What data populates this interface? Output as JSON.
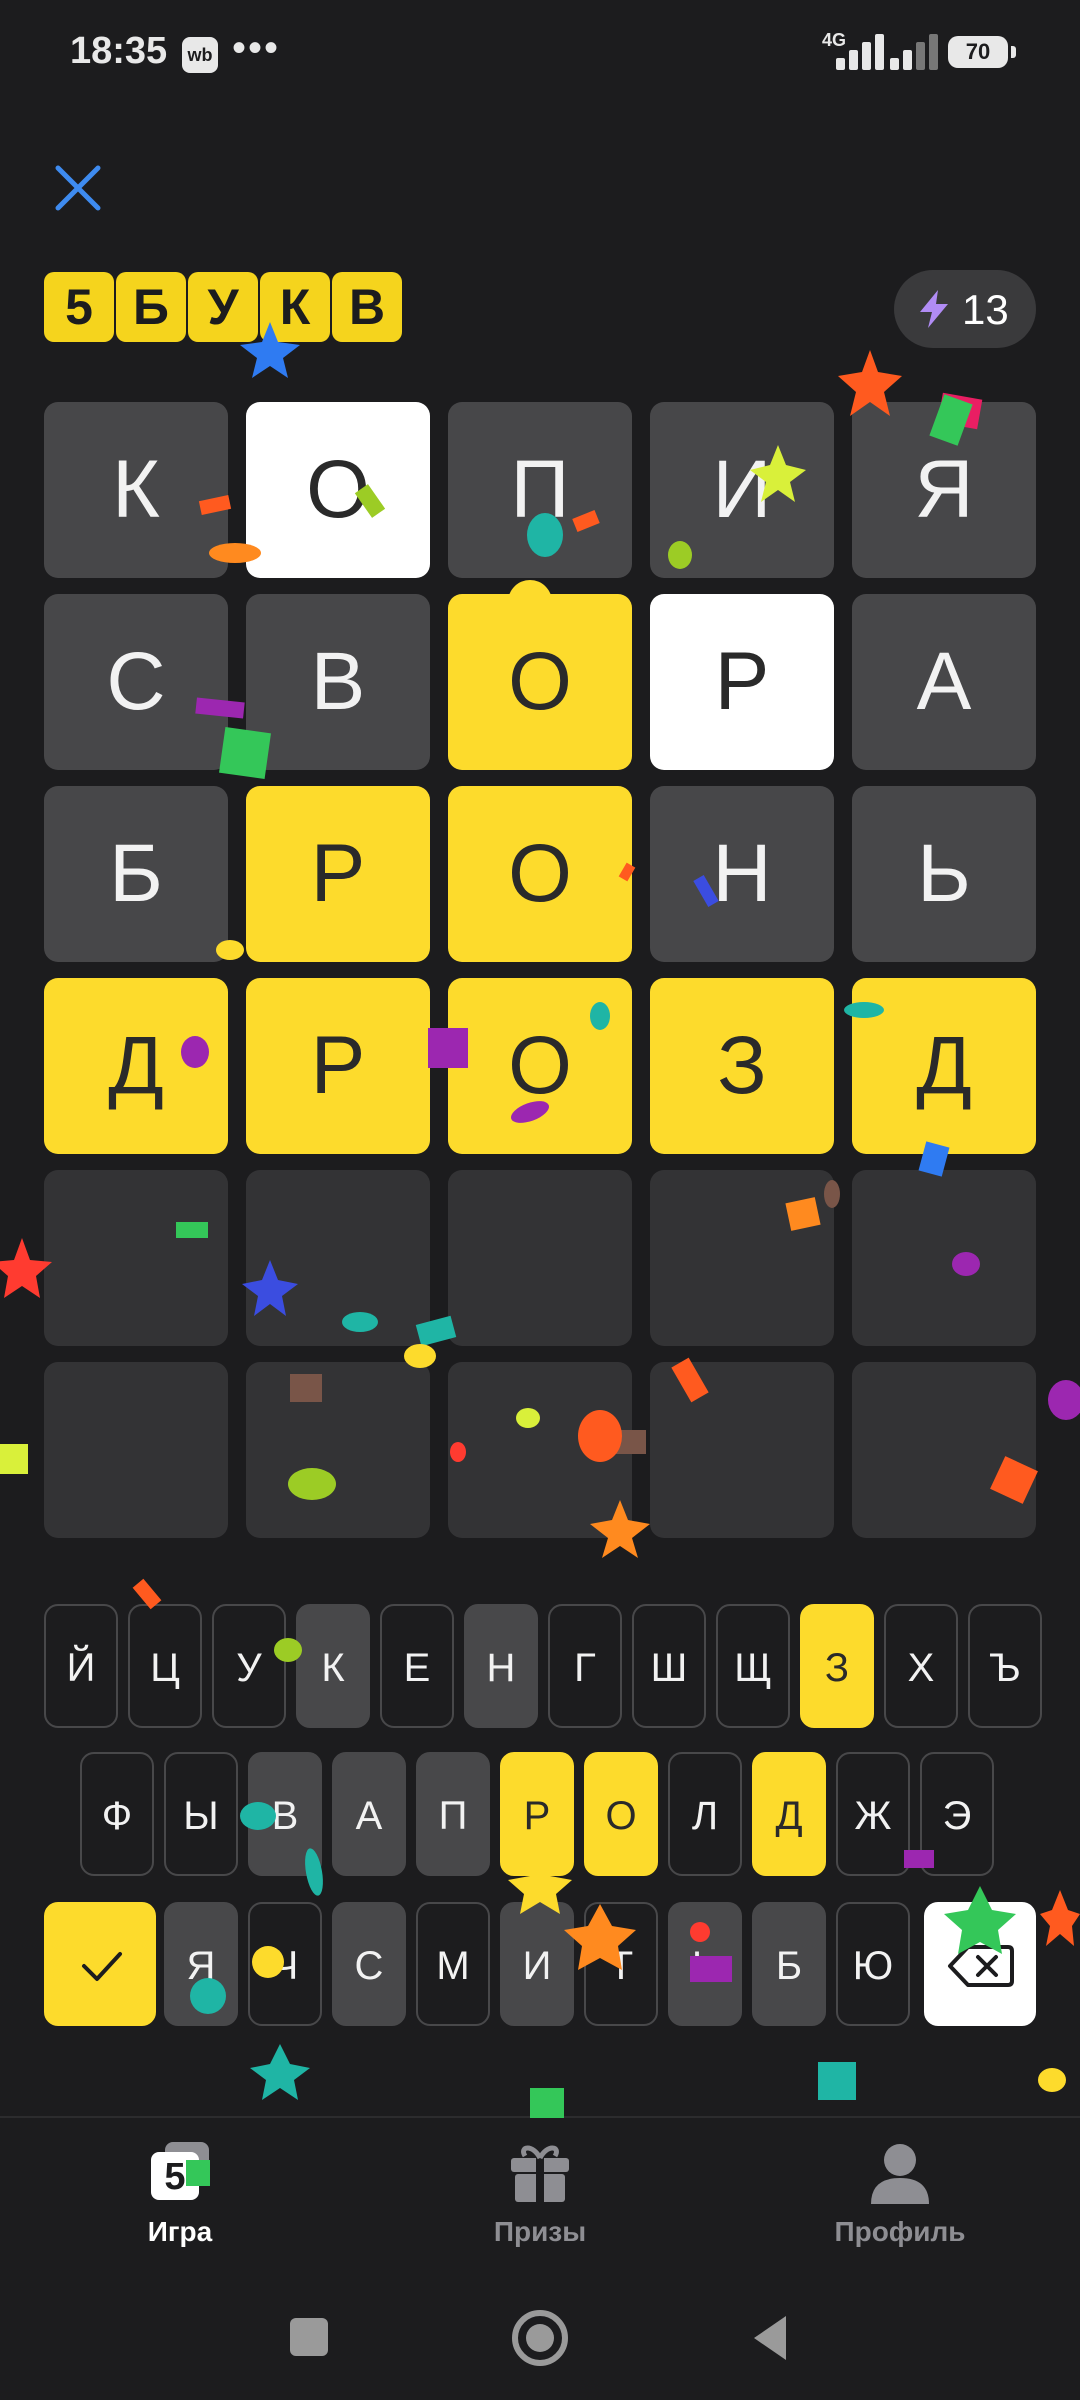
{
  "status_bar": {
    "time": "18:35",
    "app_badge": "wb",
    "more": "•••",
    "network": "4G",
    "battery": "70"
  },
  "header": {
    "logo_letters": [
      "5",
      "Б",
      "У",
      "К",
      "В"
    ],
    "energy_count": "13"
  },
  "board": {
    "rows": [
      [
        {
          "letter": "К",
          "state": "absent"
        },
        {
          "letter": "О",
          "state": "correct-white"
        },
        {
          "letter": "П",
          "state": "absent"
        },
        {
          "letter": "И",
          "state": "absent"
        },
        {
          "letter": "Я",
          "state": "absent"
        }
      ],
      [
        {
          "letter": "С",
          "state": "absent"
        },
        {
          "letter": "В",
          "state": "absent"
        },
        {
          "letter": "О",
          "state": "correct"
        },
        {
          "letter": "Р",
          "state": "correct-white"
        },
        {
          "letter": "А",
          "state": "absent"
        }
      ],
      [
        {
          "letter": "Б",
          "state": "absent"
        },
        {
          "letter": "Р",
          "state": "correct"
        },
        {
          "letter": "О",
          "state": "correct"
        },
        {
          "letter": "Н",
          "state": "absent"
        },
        {
          "letter": "Ь",
          "state": "absent"
        }
      ],
      [
        {
          "letter": "Д",
          "state": "correct"
        },
        {
          "letter": "Р",
          "state": "correct"
        },
        {
          "letter": "О",
          "state": "correct"
        },
        {
          "letter": "З",
          "state": "correct"
        },
        {
          "letter": "Д",
          "state": "correct"
        }
      ],
      [
        {
          "letter": "",
          "state": "empty"
        },
        {
          "letter": "",
          "state": "empty"
        },
        {
          "letter": "",
          "state": "empty"
        },
        {
          "letter": "",
          "state": "empty"
        },
        {
          "letter": "",
          "state": "empty"
        }
      ],
      [
        {
          "letter": "",
          "state": "empty"
        },
        {
          "letter": "",
          "state": "empty"
        },
        {
          "letter": "",
          "state": "empty"
        },
        {
          "letter": "",
          "state": "empty"
        },
        {
          "letter": "",
          "state": "empty"
        }
      ]
    ]
  },
  "keyboard": {
    "row1": [
      {
        "k": "Й",
        "s": "none"
      },
      {
        "k": "Ц",
        "s": "none"
      },
      {
        "k": "У",
        "s": "none"
      },
      {
        "k": "К",
        "s": "gray"
      },
      {
        "k": "Е",
        "s": "none"
      },
      {
        "k": "Н",
        "s": "gray"
      },
      {
        "k": "Г",
        "s": "none"
      },
      {
        "k": "Ш",
        "s": "none"
      },
      {
        "k": "Щ",
        "s": "none"
      },
      {
        "k": "З",
        "s": "yellow"
      },
      {
        "k": "Х",
        "s": "none"
      },
      {
        "k": "Ъ",
        "s": "none"
      }
    ],
    "row2": [
      {
        "k": "Ф",
        "s": "none"
      },
      {
        "k": "Ы",
        "s": "none"
      },
      {
        "k": "В",
        "s": "gray"
      },
      {
        "k": "А",
        "s": "gray"
      },
      {
        "k": "П",
        "s": "gray"
      },
      {
        "k": "Р",
        "s": "yellow"
      },
      {
        "k": "О",
        "s": "yellow"
      },
      {
        "k": "Л",
        "s": "none"
      },
      {
        "k": "Д",
        "s": "yellow"
      },
      {
        "k": "Ж",
        "s": "none"
      },
      {
        "k": "Э",
        "s": "none"
      }
    ],
    "row3": [
      {
        "k": "Я",
        "s": "gray"
      },
      {
        "k": "Ч",
        "s": "none"
      },
      {
        "k": "С",
        "s": "gray"
      },
      {
        "k": "М",
        "s": "none"
      },
      {
        "k": "И",
        "s": "gray"
      },
      {
        "k": "Т",
        "s": "none"
      },
      {
        "k": "Ь",
        "s": "gray"
      },
      {
        "k": "Б",
        "s": "gray"
      },
      {
        "k": "Ю",
        "s": "none"
      }
    ]
  },
  "nav": {
    "game": "Игра",
    "prizes": "Призы",
    "profile": "Профиль"
  },
  "colors": {
    "accent": "#fddb2c",
    "background": "#1c1c1e",
    "tile_gray": "#474749"
  }
}
